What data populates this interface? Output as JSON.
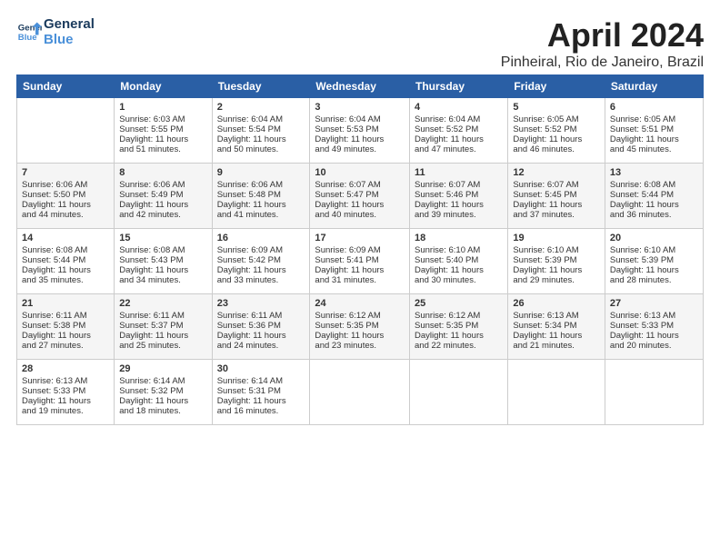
{
  "header": {
    "logo_line1": "General",
    "logo_line2": "Blue",
    "title": "April 2024",
    "subtitle": "Pinheiral, Rio de Janeiro, Brazil"
  },
  "days_of_week": [
    "Sunday",
    "Monday",
    "Tuesday",
    "Wednesday",
    "Thursday",
    "Friday",
    "Saturday"
  ],
  "weeks": [
    [
      {
        "day": "",
        "info": ""
      },
      {
        "day": "1",
        "info": "Sunrise: 6:03 AM\nSunset: 5:55 PM\nDaylight: 11 hours\nand 51 minutes."
      },
      {
        "day": "2",
        "info": "Sunrise: 6:04 AM\nSunset: 5:54 PM\nDaylight: 11 hours\nand 50 minutes."
      },
      {
        "day": "3",
        "info": "Sunrise: 6:04 AM\nSunset: 5:53 PM\nDaylight: 11 hours\nand 49 minutes."
      },
      {
        "day": "4",
        "info": "Sunrise: 6:04 AM\nSunset: 5:52 PM\nDaylight: 11 hours\nand 47 minutes."
      },
      {
        "day": "5",
        "info": "Sunrise: 6:05 AM\nSunset: 5:52 PM\nDaylight: 11 hours\nand 46 minutes."
      },
      {
        "day": "6",
        "info": "Sunrise: 6:05 AM\nSunset: 5:51 PM\nDaylight: 11 hours\nand 45 minutes."
      }
    ],
    [
      {
        "day": "7",
        "info": "Sunrise: 6:06 AM\nSunset: 5:50 PM\nDaylight: 11 hours\nand 44 minutes."
      },
      {
        "day": "8",
        "info": "Sunrise: 6:06 AM\nSunset: 5:49 PM\nDaylight: 11 hours\nand 42 minutes."
      },
      {
        "day": "9",
        "info": "Sunrise: 6:06 AM\nSunset: 5:48 PM\nDaylight: 11 hours\nand 41 minutes."
      },
      {
        "day": "10",
        "info": "Sunrise: 6:07 AM\nSunset: 5:47 PM\nDaylight: 11 hours\nand 40 minutes."
      },
      {
        "day": "11",
        "info": "Sunrise: 6:07 AM\nSunset: 5:46 PM\nDaylight: 11 hours\nand 39 minutes."
      },
      {
        "day": "12",
        "info": "Sunrise: 6:07 AM\nSunset: 5:45 PM\nDaylight: 11 hours\nand 37 minutes."
      },
      {
        "day": "13",
        "info": "Sunrise: 6:08 AM\nSunset: 5:44 PM\nDaylight: 11 hours\nand 36 minutes."
      }
    ],
    [
      {
        "day": "14",
        "info": "Sunrise: 6:08 AM\nSunset: 5:44 PM\nDaylight: 11 hours\nand 35 minutes."
      },
      {
        "day": "15",
        "info": "Sunrise: 6:08 AM\nSunset: 5:43 PM\nDaylight: 11 hours\nand 34 minutes."
      },
      {
        "day": "16",
        "info": "Sunrise: 6:09 AM\nSunset: 5:42 PM\nDaylight: 11 hours\nand 33 minutes."
      },
      {
        "day": "17",
        "info": "Sunrise: 6:09 AM\nSunset: 5:41 PM\nDaylight: 11 hours\nand 31 minutes."
      },
      {
        "day": "18",
        "info": "Sunrise: 6:10 AM\nSunset: 5:40 PM\nDaylight: 11 hours\nand 30 minutes."
      },
      {
        "day": "19",
        "info": "Sunrise: 6:10 AM\nSunset: 5:39 PM\nDaylight: 11 hours\nand 29 minutes."
      },
      {
        "day": "20",
        "info": "Sunrise: 6:10 AM\nSunset: 5:39 PM\nDaylight: 11 hours\nand 28 minutes."
      }
    ],
    [
      {
        "day": "21",
        "info": "Sunrise: 6:11 AM\nSunset: 5:38 PM\nDaylight: 11 hours\nand 27 minutes."
      },
      {
        "day": "22",
        "info": "Sunrise: 6:11 AM\nSunset: 5:37 PM\nDaylight: 11 hours\nand 25 minutes."
      },
      {
        "day": "23",
        "info": "Sunrise: 6:11 AM\nSunset: 5:36 PM\nDaylight: 11 hours\nand 24 minutes."
      },
      {
        "day": "24",
        "info": "Sunrise: 6:12 AM\nSunset: 5:35 PM\nDaylight: 11 hours\nand 23 minutes."
      },
      {
        "day": "25",
        "info": "Sunrise: 6:12 AM\nSunset: 5:35 PM\nDaylight: 11 hours\nand 22 minutes."
      },
      {
        "day": "26",
        "info": "Sunrise: 6:13 AM\nSunset: 5:34 PM\nDaylight: 11 hours\nand 21 minutes."
      },
      {
        "day": "27",
        "info": "Sunrise: 6:13 AM\nSunset: 5:33 PM\nDaylight: 11 hours\nand 20 minutes."
      }
    ],
    [
      {
        "day": "28",
        "info": "Sunrise: 6:13 AM\nSunset: 5:33 PM\nDaylight: 11 hours\nand 19 minutes."
      },
      {
        "day": "29",
        "info": "Sunrise: 6:14 AM\nSunset: 5:32 PM\nDaylight: 11 hours\nand 18 minutes."
      },
      {
        "day": "30",
        "info": "Sunrise: 6:14 AM\nSunset: 5:31 PM\nDaylight: 11 hours\nand 16 minutes."
      },
      {
        "day": "",
        "info": ""
      },
      {
        "day": "",
        "info": ""
      },
      {
        "day": "",
        "info": ""
      },
      {
        "day": "",
        "info": ""
      }
    ]
  ]
}
